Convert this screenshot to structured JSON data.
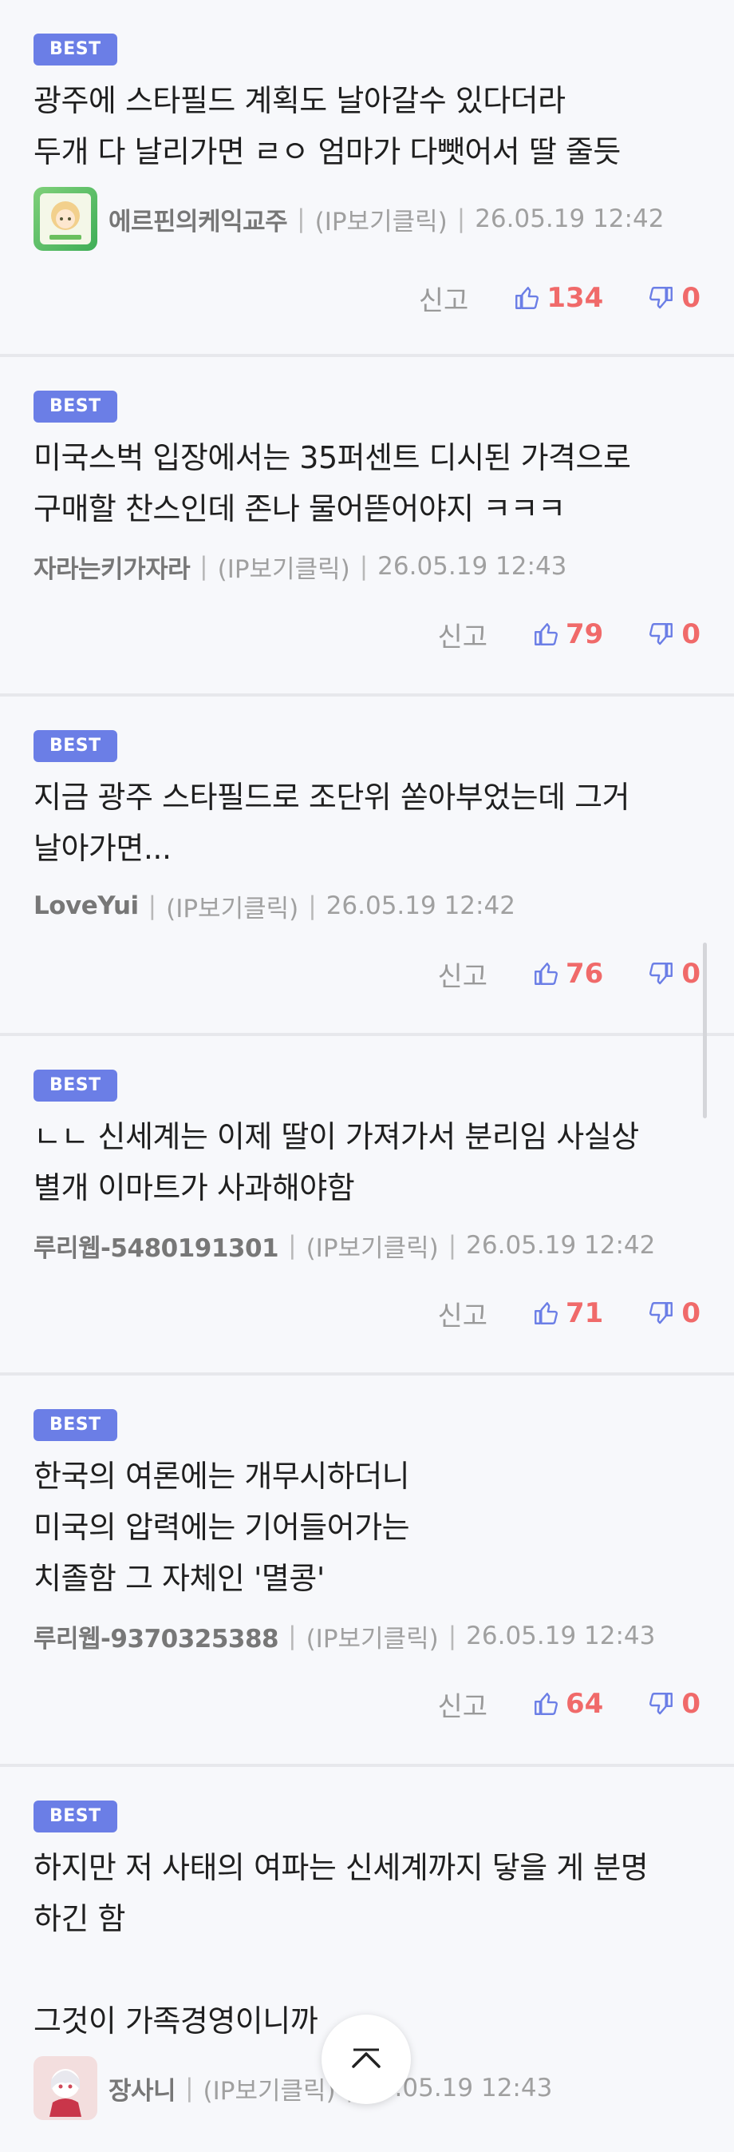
{
  "comments": [
    {
      "badge": "BEST",
      "text": "광주에 스타필드 계획도 날아갈수 있다더라\n두개 다 날리가면 ㄹㅇ 엄마가 다뺏어서 딸 줄듯",
      "author": "에르핀의케익교주",
      "ip": "(IP보기클릭)",
      "date": "26.05.19 12:42",
      "report": "신고",
      "likes": "134",
      "dislikes": "0",
      "avatar": "avatar-image"
    },
    {
      "badge": "BEST",
      "text": "미국스벅 입장에서는 35퍼센트 디시된 가격으로\n구매할 찬스인데 존나 물어뜯어야지 ㅋㅋㅋ",
      "author": "자라는키가자라",
      "ip": "(IP보기클릭)",
      "date": "26.05.19 12:43",
      "report": "신고",
      "likes": "79",
      "dislikes": "0"
    },
    {
      "badge": "BEST",
      "text": "지금 광주 스타필드로 조단위 쏟아부었는데 그거\n날아가면...",
      "author": "LoveYui",
      "ip": "(IP보기클릭)",
      "date": "26.05.19 12:42",
      "report": "신고",
      "likes": "76",
      "dislikes": "0"
    },
    {
      "badge": "BEST",
      "text": "ㄴㄴ 신세계는 이제 딸이 가져가서 분리임 사실상\n별개 이마트가 사과해야함",
      "author": "루리웹-5480191301",
      "ip": "(IP보기클릭)",
      "date": "26.05.19 12:42",
      "report": "신고",
      "likes": "71",
      "dislikes": "0"
    },
    {
      "badge": "BEST",
      "text": "한국의 여론에는 개무시하더니\n미국의 압력에는 기어들어가는\n치졸함 그 자체인 '멸콩'",
      "author": "루리웹-9370325388",
      "ip": "(IP보기클릭)",
      "date": "26.05.19 12:43",
      "report": "신고",
      "likes": "64",
      "dislikes": "0"
    },
    {
      "badge": "BEST",
      "text": "하지만 저 사태의 여파는 신세계까지 닿을 게 분명\n하긴 함\n\n그것이 가족경영이니까",
      "author": "장사니",
      "ip": "(IP보기클릭)",
      "date": "26.05.19 12:43",
      "avatar": "avatar-image"
    }
  ],
  "top_button_icon": "chevron-up-icon",
  "colors": {
    "badge": "#6b7ee6",
    "vote": "#f06a6a",
    "background": "#f7f8fb"
  }
}
